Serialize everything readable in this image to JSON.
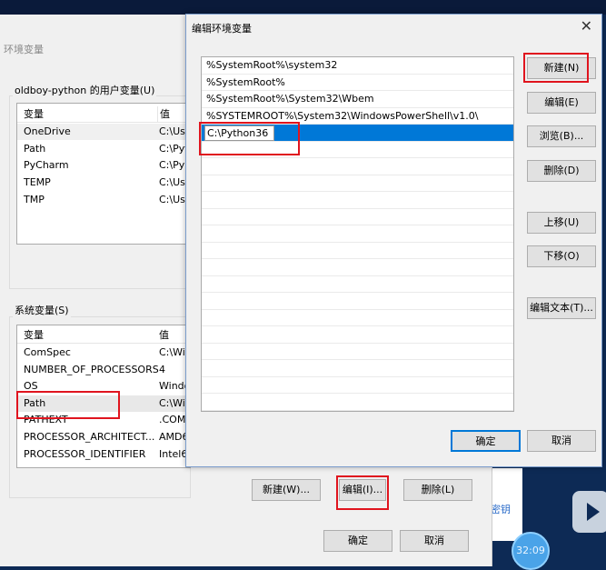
{
  "background_window": {
    "title": "环境变量",
    "user_group_label": "oldboy-python 的用户变量(U)",
    "columns": [
      "变量",
      "值"
    ],
    "user_vars": [
      [
        "OneDrive",
        "C:\\Us"
      ],
      [
        "Path",
        "C:\\Pyt"
      ],
      [
        "PyCharm",
        "C:\\Py"
      ],
      [
        "TEMP",
        "C:\\Us"
      ],
      [
        "TMP",
        "C:\\Us"
      ]
    ],
    "system_group_label": "系统变量(S)",
    "system_vars": [
      [
        "ComSpec",
        "C:\\Wi"
      ],
      [
        "NUMBER_OF_PROCESSORS",
        "4"
      ],
      [
        "OS",
        "Windo"
      ],
      [
        "Path",
        "C:\\Wi"
      ],
      [
        "PATHEXT",
        ".COM"
      ],
      [
        "PROCESSOR_ARCHITECT...",
        "AMD6"
      ],
      [
        "PROCESSOR_IDENTIFIER",
        "Intel6"
      ]
    ],
    "new_button": "新建(W)...",
    "edit_button": "编辑(I)...",
    "delete_button": "删除(L)",
    "ok_button": "确定",
    "cancel_button": "取消"
  },
  "dialog": {
    "title": "编辑环境变量",
    "paths": [
      "%SystemRoot%\\system32",
      "%SystemRoot%",
      "%SystemRoot%\\System32\\Wbem",
      "%SYSTEMROOT%\\System32\\WindowsPowerShell\\v1.0\\"
    ],
    "editing_value": "C:\\Python36",
    "buttons": {
      "new": "新建(N)",
      "edit": "编辑(E)",
      "browse": "浏览(B)...",
      "delete": "删除(D)",
      "up": "上移(U)",
      "down": "下移(O)",
      "edit_text": "编辑文本(T)..."
    },
    "ok": "确定",
    "cancel": "取消"
  },
  "overlay": {
    "link_text": "密钥",
    "timer": "32:09"
  },
  "colors": {
    "highlight": "#e0141e",
    "selection": "#0078d7"
  }
}
